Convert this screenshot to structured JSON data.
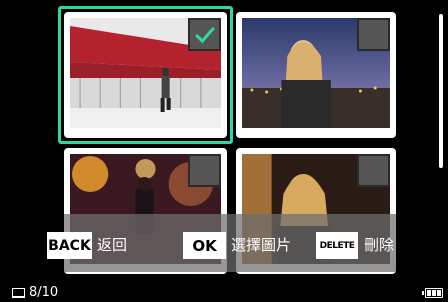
{
  "gallery": {
    "thumbnails": [
      {
        "subject": "building-walker",
        "selected": true
      },
      {
        "subject": "portrait-city-dusk",
        "selected": false
      },
      {
        "subject": "night-street-lights",
        "selected": false
      },
      {
        "subject": "portrait-warm-light",
        "selected": false
      }
    ]
  },
  "controls": {
    "back_key": "BACK",
    "back_label": "返回",
    "ok_key": "OK",
    "ok_label": "選擇圖片",
    "delete_key": "DELETE",
    "delete_label": "刪除"
  },
  "status": {
    "counter": "8/10",
    "card_icon": "memory-card-icon",
    "battery_icon": "battery-icon"
  },
  "colors": {
    "selection": "#2fd6a5",
    "background": "#000000"
  }
}
